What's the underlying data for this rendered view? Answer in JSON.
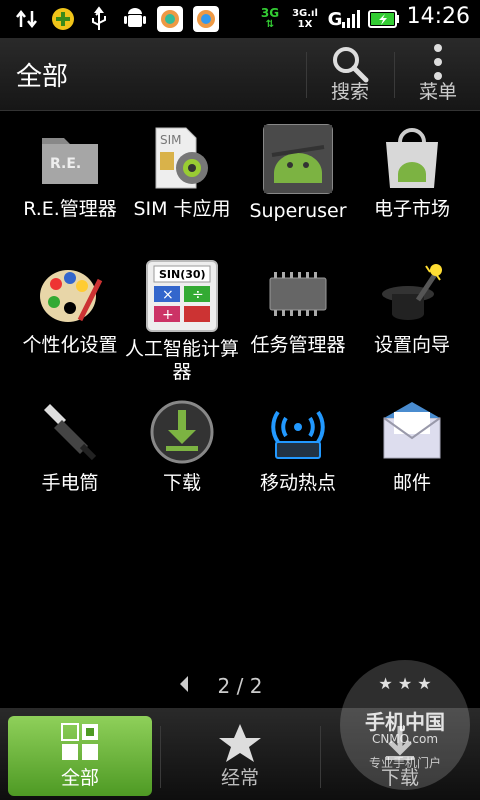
{
  "status_bar": {
    "time": "14:26",
    "network_type": "3G",
    "network_sub": "1X",
    "signal_label": "G"
  },
  "header": {
    "title": "全部",
    "search_label": "搜索",
    "menu_label": "菜单"
  },
  "apps": [
    {
      "name": "R.E.管理器",
      "icon": "folder-icon",
      "icon_text": "R.E."
    },
    {
      "name": "SIM 卡应用",
      "icon": "sim-card-gear-icon",
      "icon_text": "SIM"
    },
    {
      "name": "Superuser",
      "icon": "android-superuser-icon",
      "icon_text": ""
    },
    {
      "name": "电子市场",
      "icon": "market-bag-icon",
      "icon_text": ""
    },
    {
      "name": "个性化设置",
      "icon": "palette-icon",
      "icon_text": ""
    },
    {
      "name": "人工智能计算器",
      "icon": "calculator-icon",
      "icon_text": "SIN(30)"
    },
    {
      "name": "任务管理器",
      "icon": "chip-icon",
      "icon_text": ""
    },
    {
      "name": "设置向导",
      "icon": "magic-hat-icon",
      "icon_text": ""
    },
    {
      "name": "手电筒",
      "icon": "flashlight-icon",
      "icon_text": ""
    },
    {
      "name": "下载",
      "icon": "download-icon",
      "icon_text": ""
    },
    {
      "name": "移动热点",
      "icon": "hotspot-icon",
      "icon_text": ""
    },
    {
      "name": "邮件",
      "icon": "mail-icon",
      "icon_text": ""
    }
  ],
  "pager": {
    "text": "2 / 2"
  },
  "bottom_tabs": {
    "all_label": "全部",
    "frequent_label": "经常",
    "download_label": "下载"
  },
  "watermark": {
    "brand": "手机中国",
    "url": "CNMO.com",
    "slogan": "专业手机门户"
  },
  "colors": {
    "active_tab": "#6ab23a",
    "background": "#000000"
  }
}
